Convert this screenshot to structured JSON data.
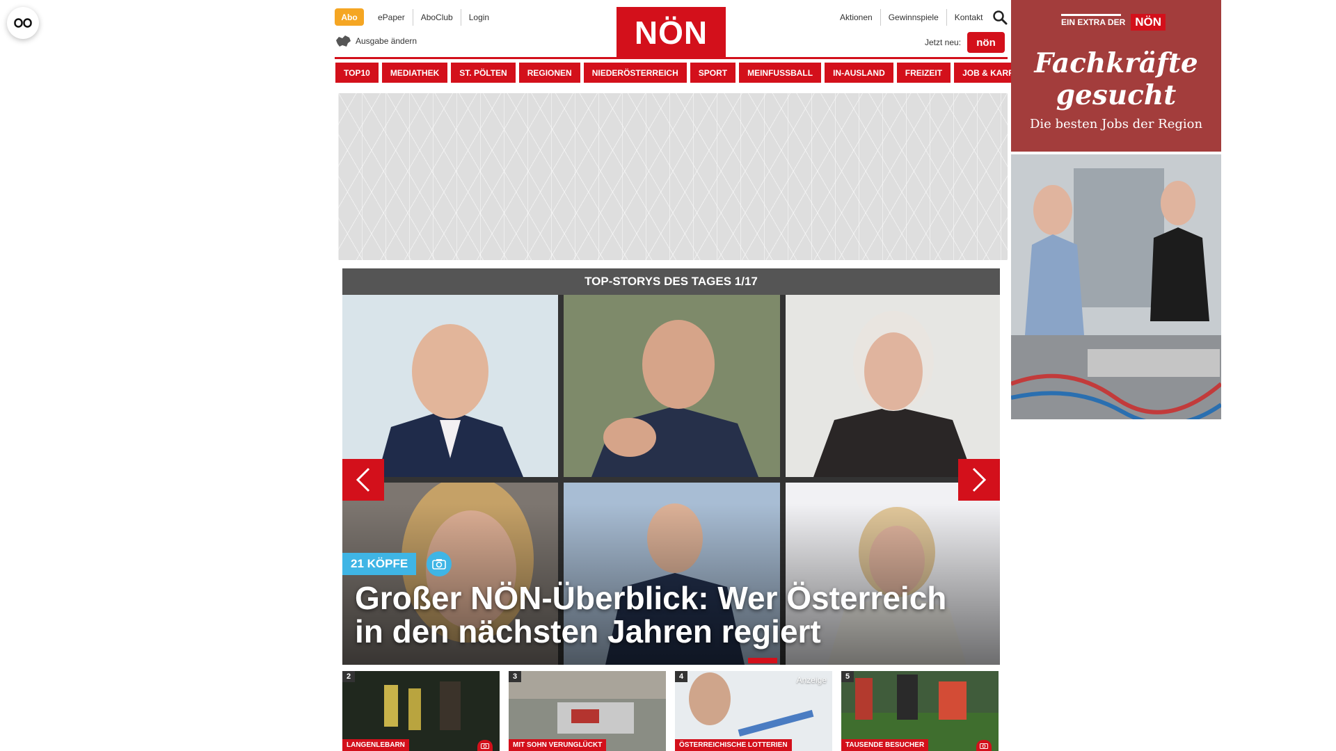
{
  "header": {
    "abo_label": "Abo",
    "left_links": [
      "ePaper",
      "AboClub",
      "Login"
    ],
    "logo_text": "NÖN",
    "right_links": [
      "Aktionen",
      "Gewinnspiele",
      "Kontakt"
    ],
    "edition_label": "Ausgabe ändern",
    "jetzt_label": "Jetzt neu:",
    "jetzt_badge": "nön"
  },
  "nav": {
    "items": [
      "TOP10",
      "MEDIATHEK",
      "ST. PÖLTEN",
      "REGIONEN",
      "NIEDERÖSTERREICH",
      "SPORT",
      "MEINFUSSBALL",
      "IN-AUSLAND",
      "FREIZEIT",
      "JOB & KARRIERE"
    ]
  },
  "topstories": {
    "bar_title": "TOP-STORYS DES TAGES 1/17",
    "badge": "21 KÖPFE",
    "headline": "Großer NÖN-Überblick: Wer Österreich in den nächsten Jahren regiert"
  },
  "thumbs": [
    {
      "num": "2",
      "category": "LANGENLEBARN",
      "has_camera": true
    },
    {
      "num": "3",
      "category": "MIT SOHN VERUNGLÜCKT",
      "has_camera": false
    },
    {
      "num": "4",
      "category": "ÖSTERREICHISCHE LOTTERIEN",
      "has_camera": false,
      "ad_label": "Anzeige"
    },
    {
      "num": "5",
      "category": "TAUSENDE BESUCHER",
      "has_camera": true
    }
  ],
  "sidead": {
    "extra_label": "EIN EXTRA DER",
    "extra_logo": "NÖN",
    "headline": "Fachkräfte gesucht",
    "subline": "Die besten Jobs der Region"
  },
  "colors": {
    "brand_red": "#d3101b",
    "abo_orange": "#f5a623",
    "badge_blue": "#3fb5e5",
    "ad_red": "#a33d3c"
  }
}
